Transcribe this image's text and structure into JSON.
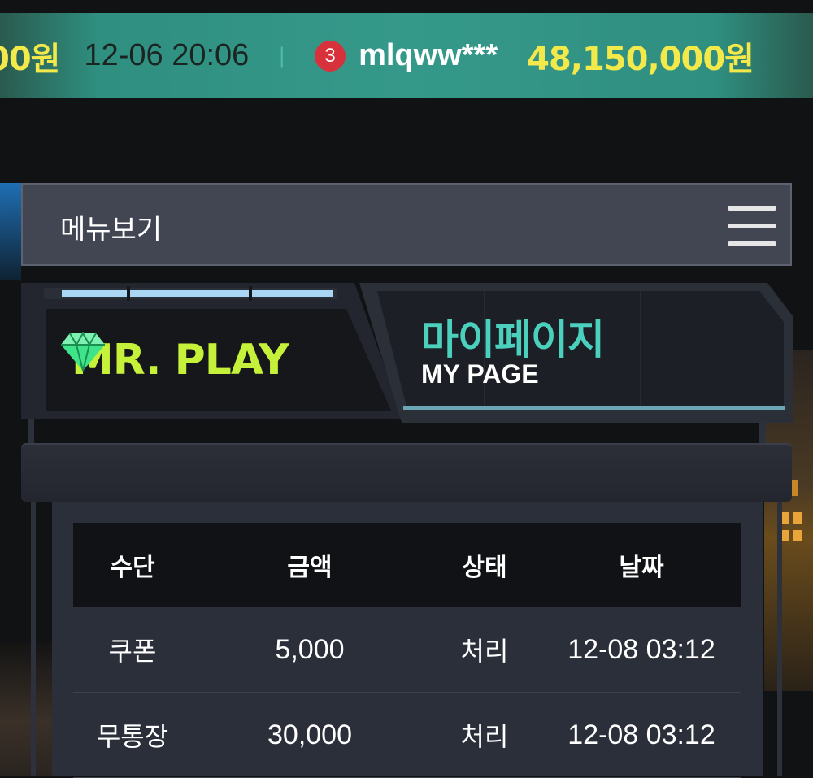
{
  "ticker": {
    "partial_amount": "00원",
    "time": "12-06 20:06",
    "separator": "|",
    "rank": "3",
    "username": "mlqww***",
    "amount": "48,150,000원"
  },
  "menu": {
    "label": "메뉴보기"
  },
  "header": {
    "brand": "MR. PLAY",
    "title_ko": "마이페이지",
    "title_en": "MY PAGE"
  },
  "table": {
    "columns": [
      "수단",
      "금액",
      "상태",
      "날짜"
    ],
    "rows": [
      [
        "쿠폰",
        "5,000",
        "처리",
        "12-08 03:12"
      ],
      [
        "무통장",
        "30,000",
        "처리",
        "12-08 03:12"
      ]
    ]
  },
  "colors": {
    "ticker_bg": "#35998a",
    "amount_yellow": "#f3e94a",
    "rank_badge": "#d7323b",
    "brand_green": "#c6f13a",
    "title_teal": "#4bd0bd",
    "menubar_bg": "#424653"
  },
  "icons": [
    "diamond-icon",
    "hamburger-icon"
  ]
}
